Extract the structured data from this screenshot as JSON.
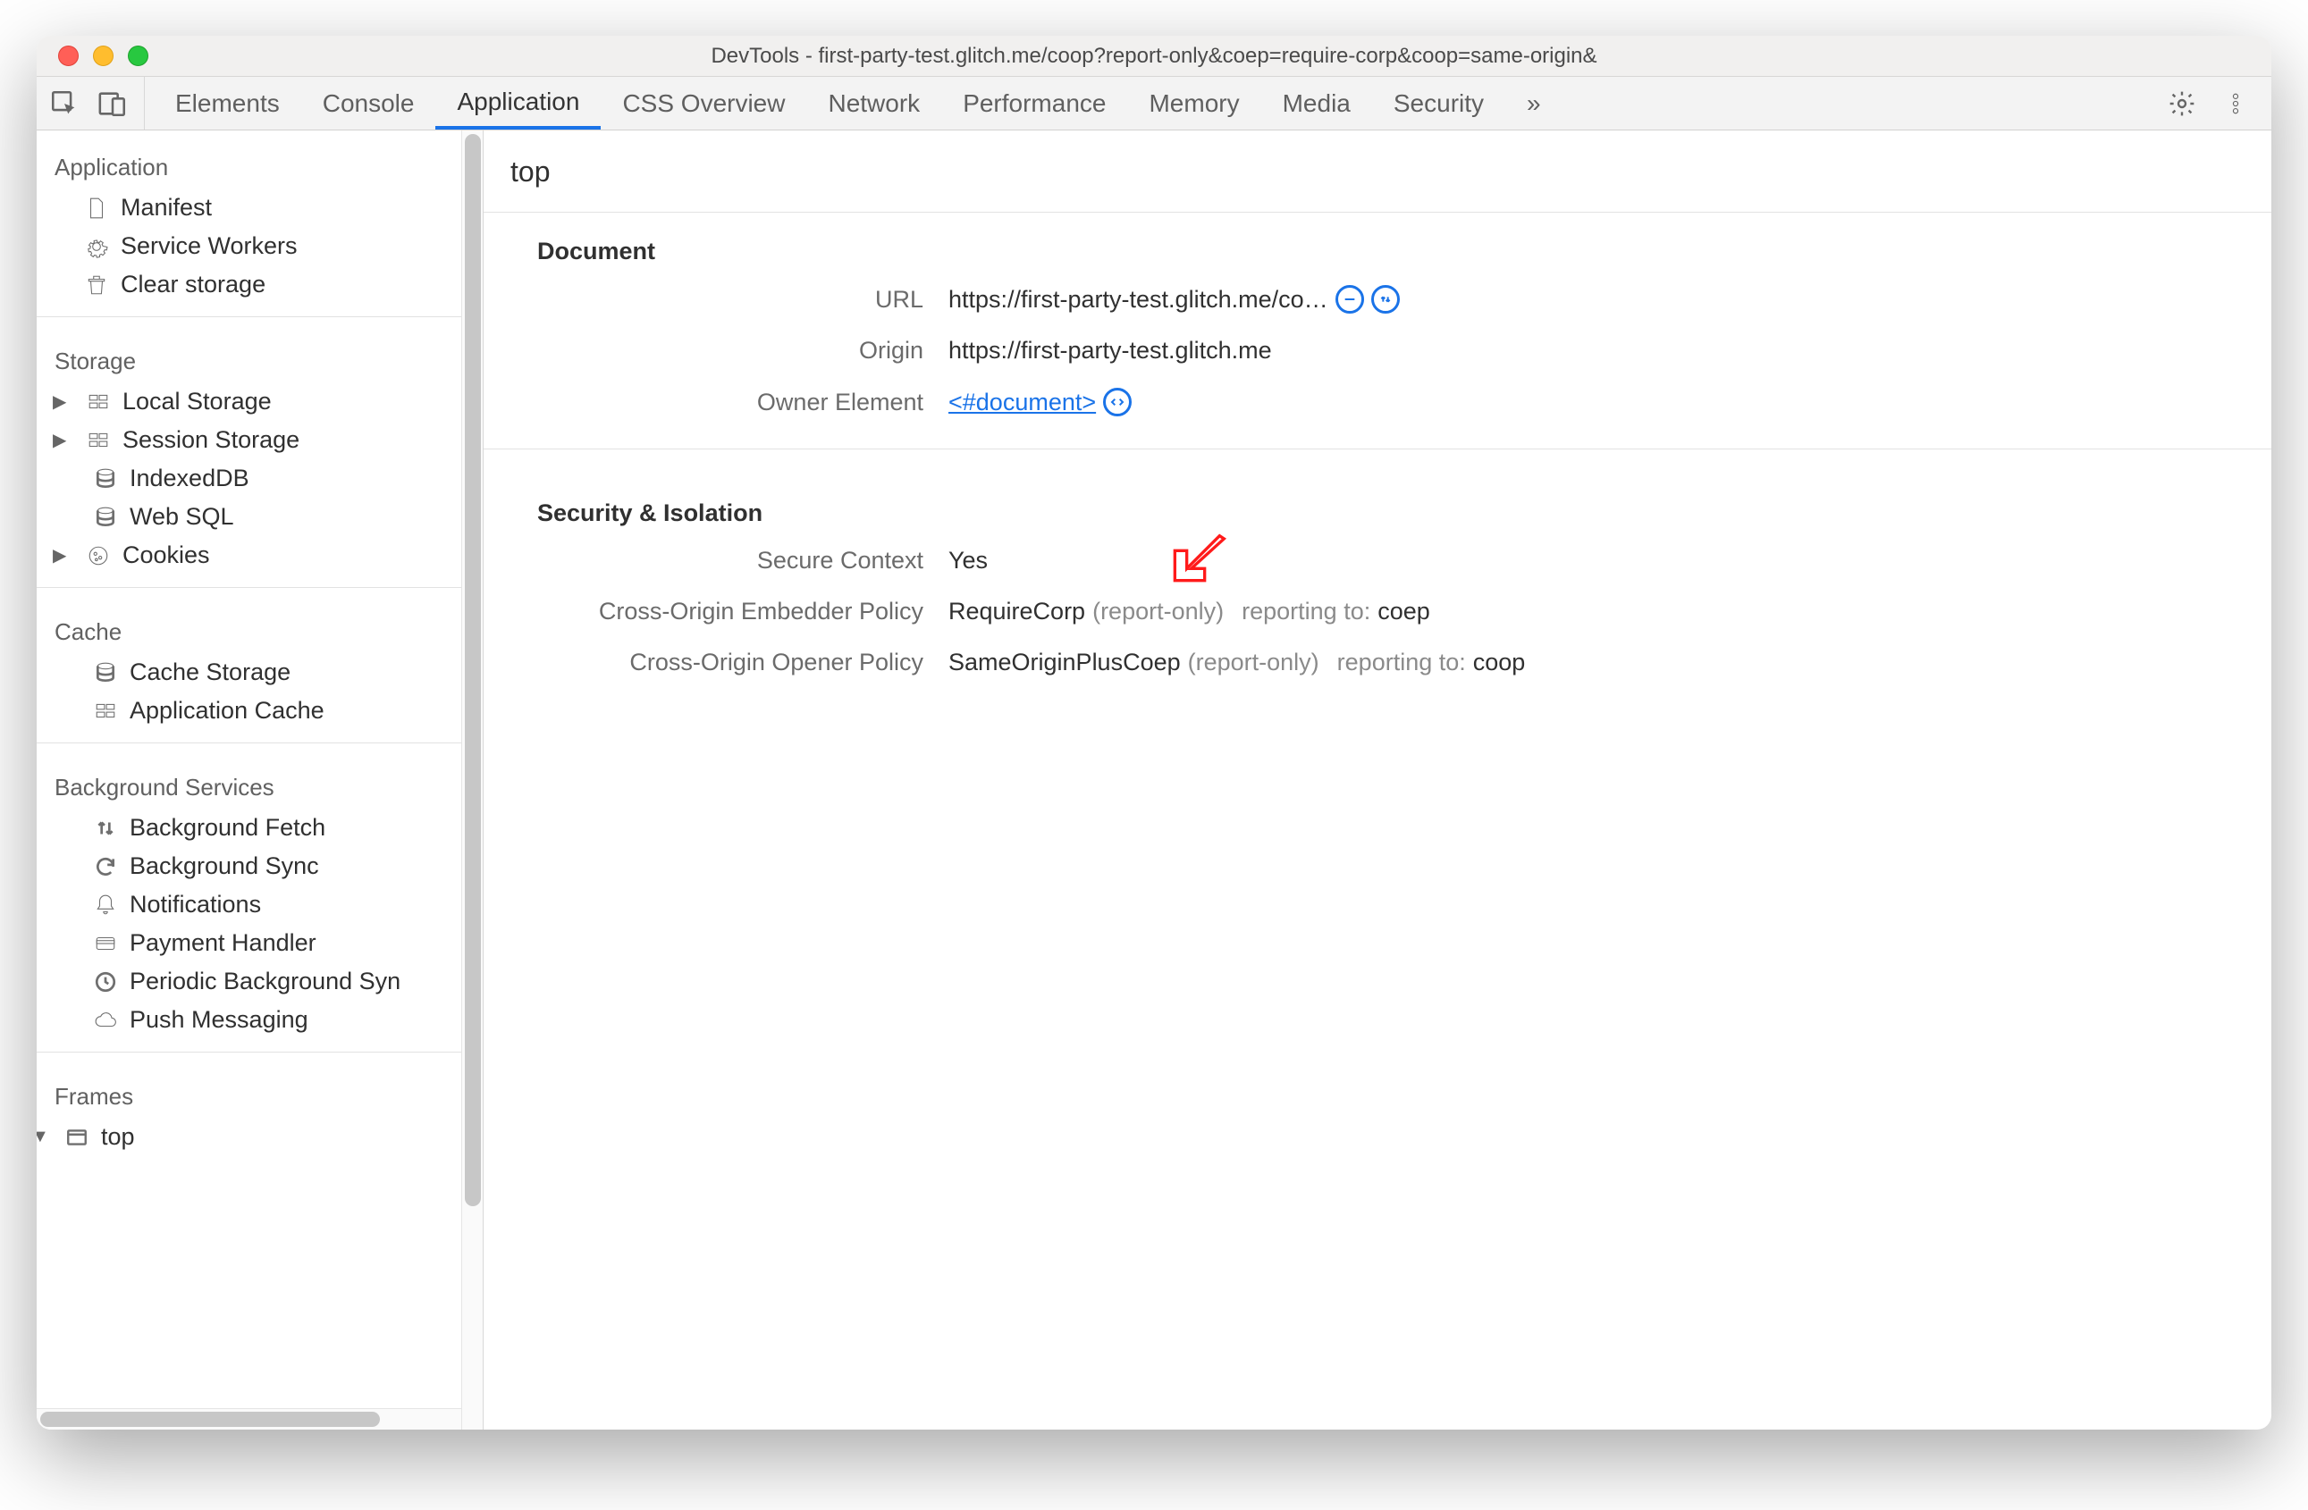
{
  "window": {
    "title": "DevTools - first-party-test.glitch.me/coop?report-only&coep=require-corp&coop=same-origin&"
  },
  "tabs": {
    "items": [
      "Elements",
      "Console",
      "Application",
      "CSS Overview",
      "Network",
      "Performance",
      "Memory",
      "Media",
      "Security"
    ],
    "active_index": 2,
    "overflow": "»"
  },
  "sidebar": {
    "sections": [
      {
        "title": "Application",
        "items": [
          {
            "icon": "file",
            "label": "Manifest"
          },
          {
            "icon": "gear",
            "label": "Service Workers"
          },
          {
            "icon": "trash",
            "label": "Clear storage"
          }
        ]
      },
      {
        "title": "Storage",
        "items": [
          {
            "icon": "grid",
            "label": "Local Storage",
            "expandable": true
          },
          {
            "icon": "grid",
            "label": "Session Storage",
            "expandable": true
          },
          {
            "icon": "db",
            "label": "IndexedDB"
          },
          {
            "icon": "db",
            "label": "Web SQL"
          },
          {
            "icon": "cookie",
            "label": "Cookies",
            "expandable": true
          }
        ]
      },
      {
        "title": "Cache",
        "items": [
          {
            "icon": "db",
            "label": "Cache Storage"
          },
          {
            "icon": "grid",
            "label": "Application Cache"
          }
        ]
      },
      {
        "title": "Background Services",
        "items": [
          {
            "icon": "updown",
            "label": "Background Fetch"
          },
          {
            "icon": "sync",
            "label": "Background Sync"
          },
          {
            "icon": "bell",
            "label": "Notifications"
          },
          {
            "icon": "card",
            "label": "Payment Handler"
          },
          {
            "icon": "clock",
            "label": "Periodic Background Syn"
          },
          {
            "icon": "cloud",
            "label": "Push Messaging"
          }
        ]
      },
      {
        "title": "Frames",
        "items": [
          {
            "icon": "window",
            "label": "top",
            "expandable": true,
            "expanded": true,
            "selected": false
          }
        ]
      }
    ]
  },
  "main": {
    "heading": "top",
    "document": {
      "section_title": "Document",
      "url_label": "URL",
      "url_value": "https://first-party-test.glitch.me/co…",
      "origin_label": "Origin",
      "origin_value": "https://first-party-test.glitch.me",
      "owner_label": "Owner Element",
      "owner_value": "<#document>"
    },
    "security": {
      "section_title": "Security & Isolation",
      "secure_context_label": "Secure Context",
      "secure_context_value": "Yes",
      "coep_label": "Cross-Origin Embedder Policy",
      "coep_value": "RequireCorp",
      "coep_mode": "(report-only)",
      "coep_reporting_prefix": "reporting to:",
      "coep_reporting_to": "coep",
      "coop_label": "Cross-Origin Opener Policy",
      "coop_value": "SameOriginPlusCoep",
      "coop_mode": "(report-only)",
      "coop_reporting_prefix": "reporting to:",
      "coop_reporting_to": "coop"
    }
  },
  "icons": {
    "inspect": "inspect-icon",
    "device": "device-icon",
    "settings": "gear-icon",
    "more": "more-vertical-icon",
    "reveal": "reveal-icon",
    "network": "network-icon",
    "code": "code-icon"
  }
}
